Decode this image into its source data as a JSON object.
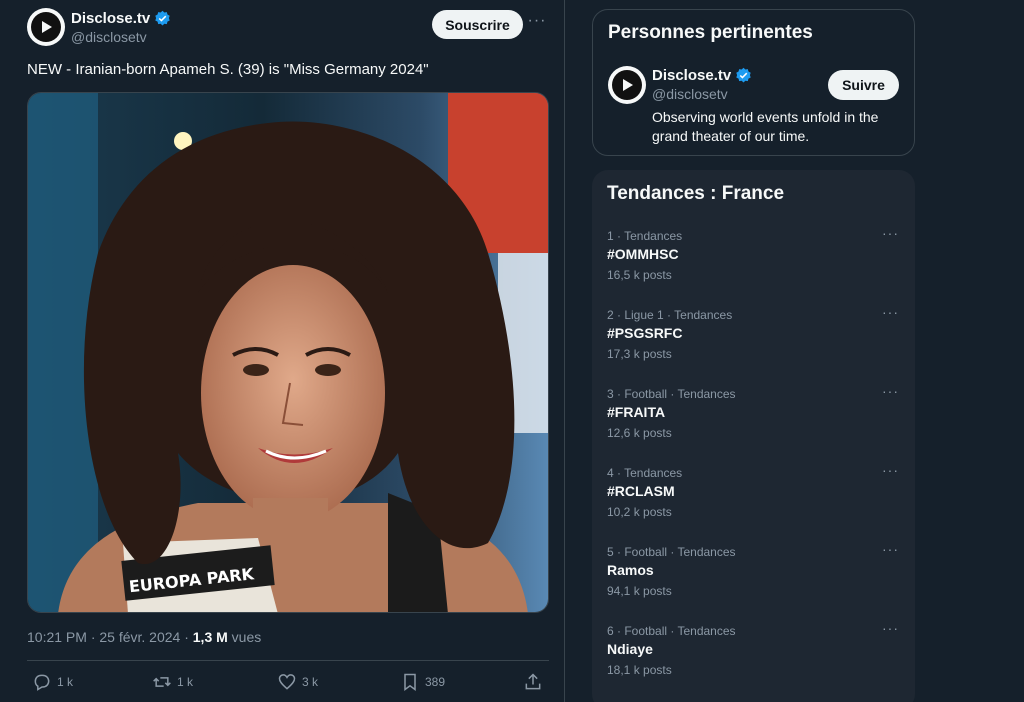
{
  "tweet": {
    "author_name": "Disclose.tv",
    "author_handle": "@disclosetv",
    "subscribe_label": "Souscrire",
    "more_glyph": "···",
    "text": "NEW - Iranian-born Apameh S. (39) is \"Miss Germany 2024\"",
    "image_sash_text": "EUROPA PARK",
    "timestamp": "10:21 PM · 25 févr. 2024 · ",
    "views_count": "1,3 M",
    "views_label": " vues",
    "replies": "1 k",
    "retweets": "1 k",
    "likes": "3 k",
    "bookmarks": "389"
  },
  "people": {
    "title": "Personnes pertinentes",
    "name": "Disclose.tv",
    "handle": "@disclosetv",
    "follow_label": "Suivre",
    "bio": "Observing world events unfold in the grand theater of our time."
  },
  "trends": {
    "title": "Tendances : France",
    "items": [
      {
        "context": "1 · Tendances",
        "name": "#OMMHSC",
        "count": "16,5 k posts"
      },
      {
        "context": "2 · Ligue 1 · Tendances",
        "name": "#PSGSRFC",
        "count": "17,3 k posts"
      },
      {
        "context": "3 · Football · Tendances",
        "name": "#FRAITA",
        "count": "12,6 k posts"
      },
      {
        "context": "4 · Tendances",
        "name": "#RCLASM",
        "count": "10,2 k posts"
      },
      {
        "context": "5 · Football · Tendances",
        "name": "Ramos",
        "count": "94,1 k posts"
      },
      {
        "context": "6 · Football · Tendances",
        "name": "Ndiaye",
        "count": "18,1 k posts"
      }
    ]
  },
  "colors": {
    "background": "#15202b",
    "border": "#38444d",
    "muted_text": "#8b98a5",
    "verified_blue": "#1d9bf0"
  }
}
